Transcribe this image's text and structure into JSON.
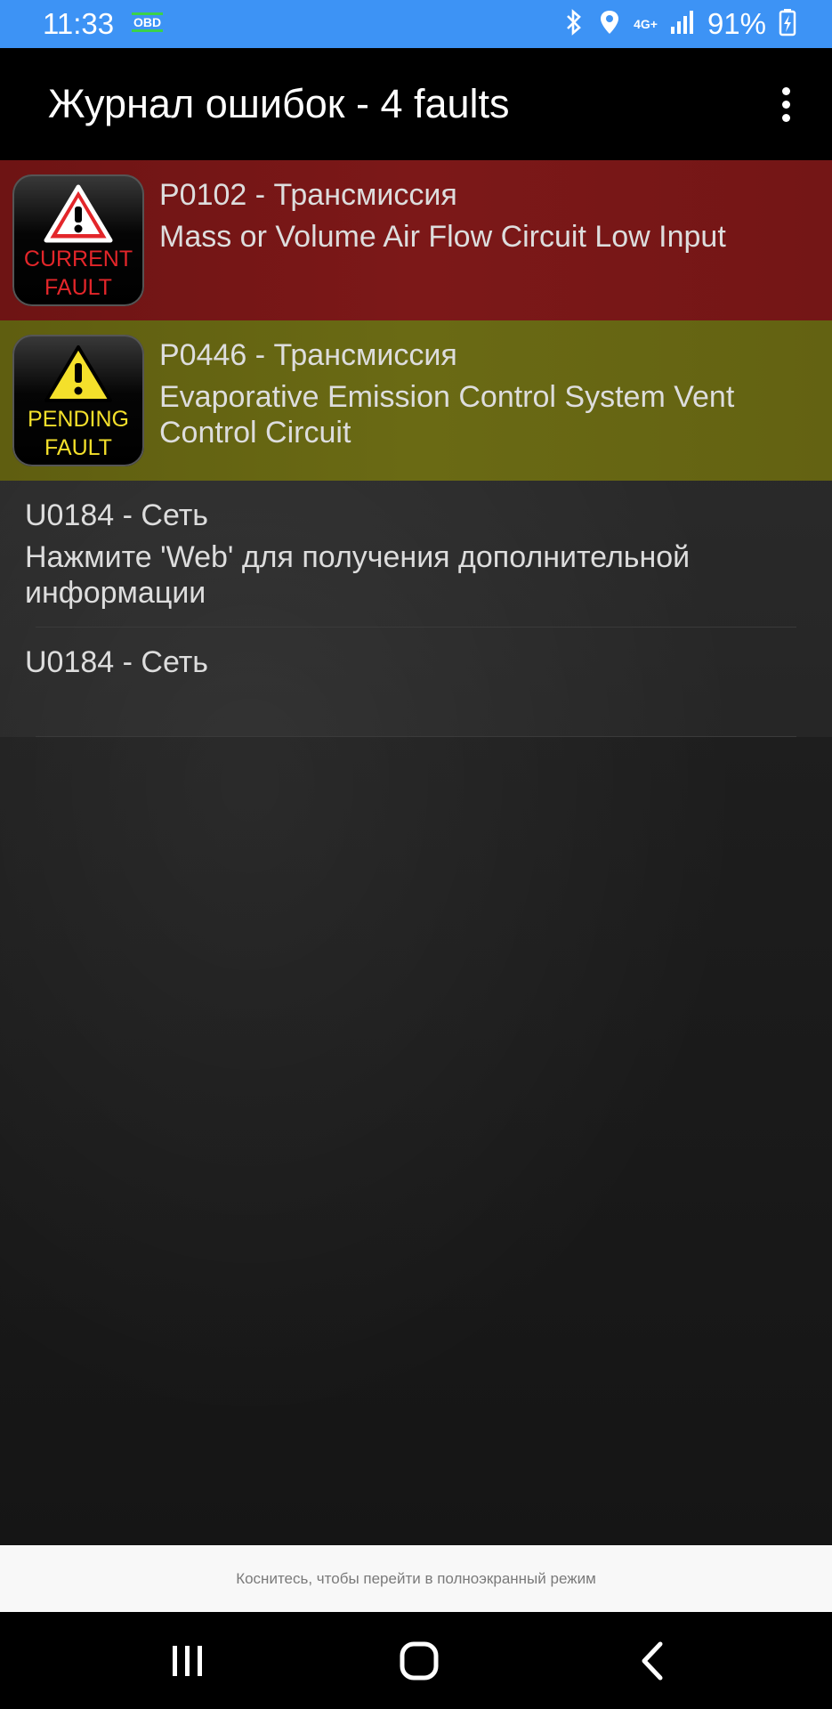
{
  "status_bar": {
    "time": "11:33",
    "obd_label": "OBD",
    "network": "4G+",
    "battery": "91%"
  },
  "toolbar": {
    "title": "Журнал ошибок - 4 faults"
  },
  "faults": [
    {
      "code": "P0102 - Трансмиссия",
      "description": "Mass or Volume Air Flow Circuit Low Input",
      "badge_line1": "CURRENT",
      "badge_line2": "FAULT",
      "badge_color": "#e3262a",
      "row_color": "#7a1717"
    },
    {
      "code": "P0446 - Трансмиссия",
      "description": "Evaporative Emission Control System Vent Control Circuit",
      "badge_line1": "PENDING",
      "badge_line2": "FAULT",
      "badge_color": "#f4e02b",
      "row_color": "#696813"
    },
    {
      "code": "U0184 - Сеть",
      "description": "Нажмите 'Web' для получения дополнительной информации"
    },
    {
      "code": "U0184 - Сеть",
      "description": ""
    }
  ],
  "fullscreen_hint": "Коснитесь, чтобы перейти в полноэкранный режим",
  "icons": {
    "menu": "more-vert-icon",
    "warning": "warning-triangle-icon",
    "bluetooth": "bluetooth-icon",
    "location": "location-icon",
    "signal": "signal-icon",
    "battery": "battery-charging-icon",
    "nav_recent": "recent-apps-icon",
    "nav_home": "home-icon",
    "nav_back": "back-icon"
  },
  "colors": {
    "status_bar": "#3d93f5",
    "toolbar": "#000000"
  }
}
